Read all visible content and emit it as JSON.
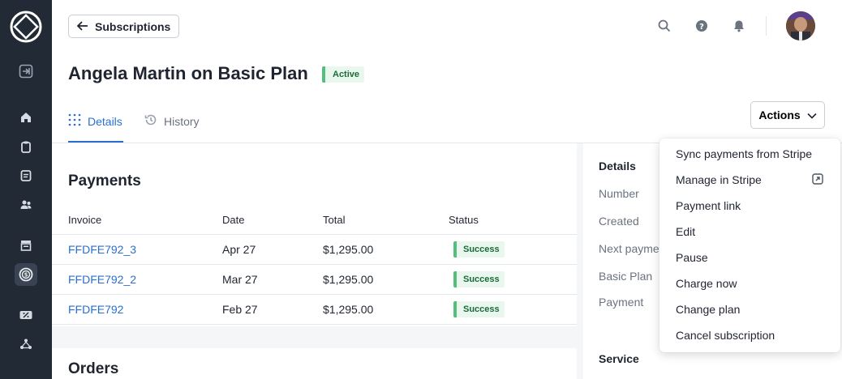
{
  "header": {
    "back_label": "Subscriptions"
  },
  "page": {
    "title": "Angela Martin on Basic Plan",
    "status_badge": "Active"
  },
  "tabs": [
    {
      "label": "Details",
      "active": true
    },
    {
      "label": "History",
      "active": false
    }
  ],
  "actions": {
    "label": "Actions",
    "menu": [
      "Sync payments from Stripe",
      "Manage in Stripe",
      "Payment link",
      "Edit",
      "Pause",
      "Charge now",
      "Change plan",
      "Cancel subscription"
    ]
  },
  "payments": {
    "heading": "Payments",
    "columns": [
      "Invoice",
      "Date",
      "Total",
      "Status"
    ],
    "rows": [
      {
        "invoice": "FFDFE792_3",
        "date": "Apr 27",
        "total": "$1,295.00",
        "status": "Success"
      },
      {
        "invoice": "FFDFE792_2",
        "date": "Mar 27",
        "total": "$1,295.00",
        "status": "Success"
      },
      {
        "invoice": "FFDFE792",
        "date": "Feb 27",
        "total": "$1,295.00",
        "status": "Success"
      }
    ]
  },
  "orders": {
    "heading": "Orders"
  },
  "details_panel": {
    "heading": "Details",
    "labels": [
      "Number",
      "Created",
      "Next payme",
      "Basic Plan",
      "Payment"
    ],
    "service_heading": "Service"
  },
  "colors": {
    "sidebar_bg": "#222a36",
    "accent": "#2a6fcf",
    "success_bg": "#eaf7ee",
    "success_bar": "#52c07a",
    "success_text": "#1a6b38"
  },
  "icons": {
    "sidebar": [
      "logo-icon",
      "collapse-icon",
      "home-icon",
      "clipboard-icon",
      "document-icon",
      "users-icon",
      "storefront-icon",
      "subscription-icon",
      "discount-icon",
      "integrations-icon"
    ],
    "header": [
      "search-icon",
      "help-icon",
      "bell-icon"
    ]
  }
}
